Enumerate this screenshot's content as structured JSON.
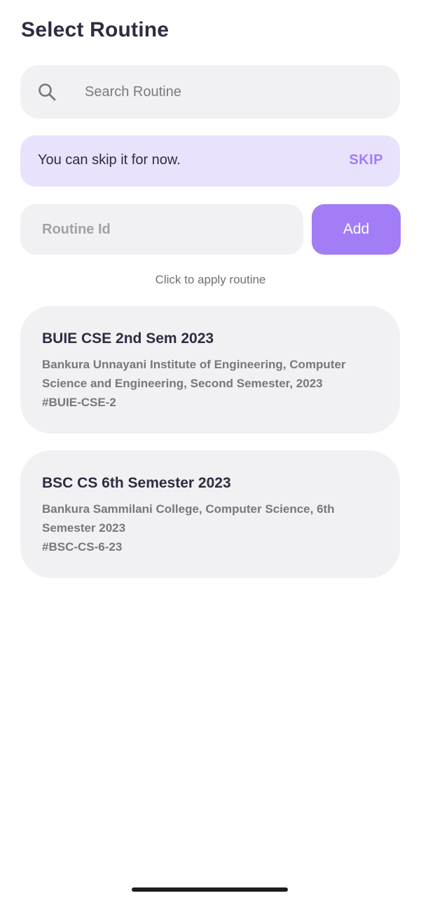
{
  "header": {
    "title": "Select Routine"
  },
  "search": {
    "placeholder": "Search Routine",
    "value": "",
    "icon": "search-icon"
  },
  "skip_banner": {
    "message": "You can skip it for now.",
    "action_label": "SKIP"
  },
  "add_routine": {
    "placeholder": "Routine Id",
    "value": "",
    "button_label": "Add"
  },
  "hint": "Click to apply routine",
  "routines": [
    {
      "title": "BUIE CSE 2nd Sem 2023",
      "description": "Bankura Unnayani Institute of Engineering, Computer Science and Engineering, Second Semester, 2023",
      "code": "#BUIE-CSE-2"
    },
    {
      "title": "BSC CS 6th Semester 2023",
      "description": "Bankura Sammilani College, Computer Science, 6th Semester 2023",
      "code": "#BSC-CS-6-23"
    }
  ],
  "colors": {
    "accent": "#a27df6",
    "banner_bg": "#e8e2fc",
    "surface": "#f1f1f3",
    "title_text": "#2e2c40"
  }
}
